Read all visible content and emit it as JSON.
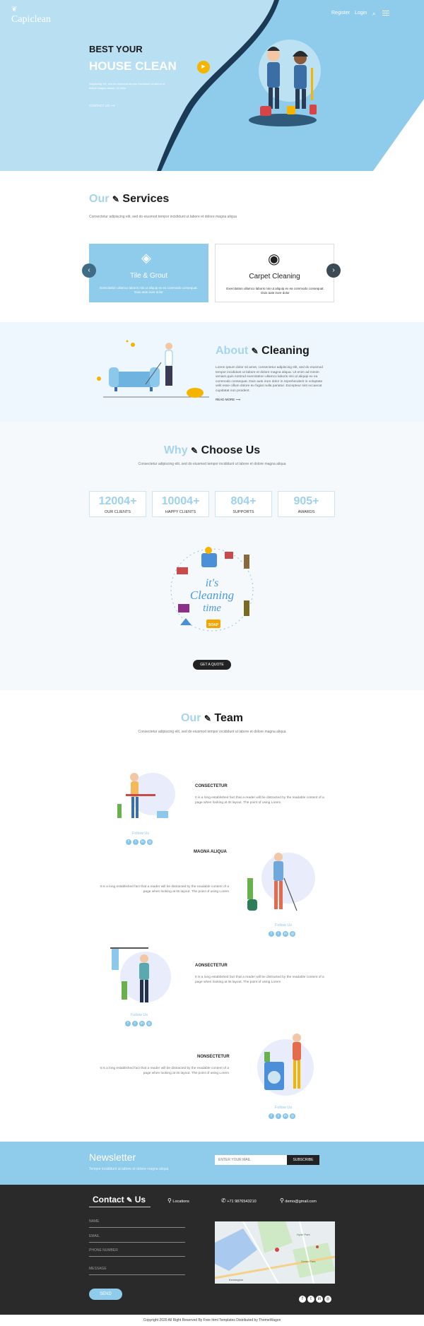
{
  "header": {
    "logo": "Capiclean",
    "nav": [
      "Register",
      "Login"
    ]
  },
  "hero": {
    "title1": "BEST YOUR",
    "title2": "HOUSE CLEAN",
    "text": "Adipiscing elit, sed do eiusmod tempor incididunt ut labore et dolore magna aliqua. Ut enim",
    "link": "CONTACT US"
  },
  "services": {
    "title_light": "Our",
    "title_dark": "Services",
    "subtitle": "Consectetur adipiscing elit, sed do eiusmod tempor incididunt ut labore et dolore magna aliqua",
    "cards": [
      {
        "title": "Tile & Grout",
        "desc": "Exercitation ullamco laboris nisi ut aliquip ex ea commodo consequat. Duis aute irure dolor"
      },
      {
        "title": "Carpet Cleaning",
        "desc": "Exercitation ullamco laboris nisi ut aliquip ex ea commodo consequat. Duis aute irure dolor"
      }
    ]
  },
  "about": {
    "title_light": "About",
    "title_dark": "Cleaning",
    "text": "Lorem ipsum dolor sit amet, consectetur adipiscing elit, sed do eiusmod tempor incididunt ut labore et dolore magna aliqua. Ut enim ad minim veniam,quis nostrud exercitation ullamco laboris nisi ut aliquip ex ea commodo consequat. Duis aute irure dolor in reprehenderit in voluptate velit esse cillum dolore eu fugiat nulla pariatur. Excepteur sint occaecat cupidatat non proident.",
    "link": "READ MORE"
  },
  "why": {
    "title_light": "Why",
    "title_dark": "Choose Us",
    "subtitle": "Consectetur adipiscing elit, sed do eiusmod tempor incididunt ut labore et dolore magna aliqua",
    "stats": [
      {
        "number": "12004+",
        "label": "OUR CLIENTS"
      },
      {
        "number": "10004+",
        "label": "HAPPY CLIENTS"
      },
      {
        "number": "804+",
        "label": "SUPPORTS"
      },
      {
        "number": "905+",
        "label": "AWARDS"
      }
    ],
    "illustration_text": [
      "it's",
      "Cleaning",
      "time"
    ],
    "badge": "SOAP",
    "button": "GET A QUOTE"
  },
  "team": {
    "title_light": "Our",
    "title_dark": "Team",
    "subtitle": "Consectetur adipiscing elit, sed do eiusmod tempor incididunt ut labore et dolore magna aliqua",
    "follow": "Follow Us",
    "members": [
      {
        "name": "CONSECTETUR",
        "desc": "It is a long established fact that a reader will be distracted by the readable content of a page when looking at its layout. The point of using Lorem"
      },
      {
        "name": "MAGNA ALIQUA",
        "desc": "It is a long established fact that a reader will be distracted by the readable content of a page when looking at its layout. The point of using Lorem"
      },
      {
        "name": "AONSECTETUR",
        "desc": "It is a long established fact that a reader will be distracted by the readable content of a page when looking at its layout. The point of using Lorem"
      },
      {
        "name": "NONSECTETUR",
        "desc": "It is a long established fact that a reader will be distracted by the readable content of a page when looking at its layout. The point of using Lorem"
      }
    ]
  },
  "newsletter": {
    "title": "Newsletter",
    "text": "Tempor incididunt ut labore et dolore magna aliqua",
    "placeholder": "ENTER YOUR MAIL",
    "button": "SUBSCRIBE"
  },
  "contact": {
    "title1": "Contact",
    "title2": "Us",
    "locations": "Locations",
    "phone": "+71 9876543210",
    "email": "demo@gmail.com",
    "fields": [
      "NAME",
      "EMAIL",
      "PHONE NUMBER",
      "MESSAGE"
    ],
    "button": "SEND",
    "map_labels": [
      "Hyde Park",
      "Kensington",
      "Green Park"
    ],
    "copyright": "Copyright 2020 All Right Reserved By Free html Templates Distributed by ThemeWagon"
  },
  "colors": {
    "accent": "#8cc8ec",
    "hero_bg": "#b9dff3",
    "dark": "#2a2a2a",
    "yellow": "#f5b400"
  }
}
